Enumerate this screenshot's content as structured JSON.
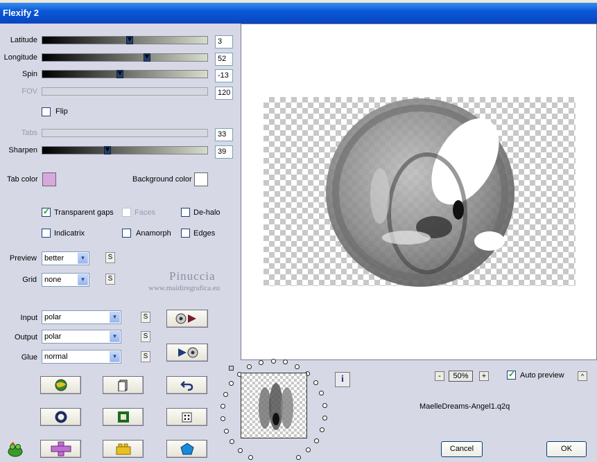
{
  "window": {
    "title": "Flexify 2"
  },
  "sliders": [
    {
      "label": "Latitude",
      "value": "3",
      "position": 0.53,
      "enabled": true
    },
    {
      "label": "Longitude",
      "value": "52",
      "position": 0.64,
      "enabled": true
    },
    {
      "label": "Spin",
      "value": "-13",
      "position": 0.47,
      "enabled": true
    },
    {
      "label": "FOV",
      "value": "120",
      "position": null,
      "enabled": false
    },
    {
      "label": "Tabs",
      "value": "33",
      "position": null,
      "enabled": false
    },
    {
      "label": "Sharpen",
      "value": "39",
      "position": 0.39,
      "enabled": true
    }
  ],
  "flip": {
    "label": "Flip",
    "checked": false
  },
  "colors": {
    "tab_label": "Tab color",
    "tab_color": "#d8a8dc",
    "bg_label": "Background color",
    "bg_color": "#ffffff",
    "accent": "#0a58d8"
  },
  "options": {
    "transparent_gaps": "Transparent gaps",
    "faces": "Faces",
    "dehalo": "De-halo",
    "indicatrix": "Indicatrix",
    "anamorph": "Anamorph",
    "edges": "Edges"
  },
  "preview_select": {
    "label": "Preview",
    "value": "better"
  },
  "grid_select": {
    "label": "Grid",
    "value": "none"
  },
  "watermark": {
    "line1": "Pinuccia",
    "line2": "www.maidiregrafica.eu"
  },
  "input_select": {
    "label": "Input",
    "value": "polar"
  },
  "output_select": {
    "label": "Output",
    "value": "polar"
  },
  "glue_select": {
    "label": "Glue",
    "value": "normal"
  },
  "swap_label": "S",
  "zoom": {
    "minus": "-",
    "value": "50%",
    "plus": "+"
  },
  "auto_preview": {
    "label": "Auto preview",
    "checked": true,
    "toggle": "^"
  },
  "info_label": "i",
  "preset_name": "MaelleDreams-Angel1.q2q",
  "cancel_label": "Cancel",
  "ok_label": "OK",
  "icons": [
    "globe-icon",
    "page-icon",
    "undo-icon",
    "ring-icon",
    "square-frame-icon",
    "dice-icon",
    "plus-shape-icon",
    "brick-icon",
    "gem-icon",
    "frog-icon",
    "camera-forward-icon",
    "camera-back-icon",
    "info-icon"
  ]
}
